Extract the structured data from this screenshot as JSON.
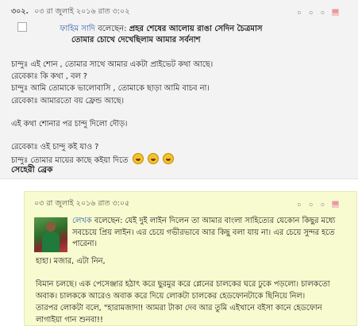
{
  "comment1": {
    "number": "৩০২.",
    "date": "০৩ রা জুলাই ২০১৬ রাত ৩:০২",
    "tools": [
      "০",
      "০",
      "০"
    ],
    "author": "ফাহিম সাদি",
    "said": "বলেছেন:",
    "title_line1": "প্রহর শেষের আলোয় রাঙা সেদিন চৈত্রমাস",
    "title_line2": "তোমার চোখে দেখেছিলাম আমার সর্বনাশ",
    "lines": [
      "চান্দুঃ এই শোন , তোমার সাথে আমার একটা প্রাইভেট কথা আছে।",
      "রেবেকাঃ কি কথা , বল ?",
      "চান্দুঃ আমি তোমাকে ভালোবাসি , তোমাকে ছাড়া আমি বাচব না।",
      "রেবেকাঃ আমারতো বয় ফ্রেন্ড আছে।",
      "",
      "এই কথা শোনার পর চান্দু দিলো দৌড়।",
      "",
      "রেবেকাঃ ওই চান্দু কই যাও ?",
      "চান্দুঃ তোমার মায়ের কাছে কইয়া দিতে"
    ],
    "signature": "সেহেরী ব্রেক",
    "emoticons": [
      "laughing-emoticon",
      "laughing-emoticon",
      "laughing-emoticon"
    ]
  },
  "comment2": {
    "date": "০৩ রা জুলাই ২০১৬ রাত ৩:০৫",
    "tools": [
      "০",
      "০",
      "০"
    ],
    "author": "লেখক",
    "said": "বলেছেন:",
    "reply": "যেই দুই লাইন দিলেন তা আমার বাংলা সাহিত্যের যেকোন কিছুর মধ্যে সবচেয়ে প্রিয় লাইন। এর চেয়ে গভীরভাবে আর কিছু বলা যায় না। এর চেয়ে সুন্দর হতে পারেনা।",
    "lines": [
      "হাহা। মজার, এটা নিন,",
      "",
      "বিমান চলছে। এক পেসেঞ্জার হঠাৎ করে ছুরমুর করে প্লেনের চালকের ঘরে ঢুকে পড়লো। চালকতো অবাক। চালককে আরেও অবাক করে দিয়ে লোকটা চালকের হেডফোনটাকে ছিনিয়ে নিল।",
      "তারপর লোকটা বলে, \"হারামজাদা! আমরা টাকা দেব আর তুমি এইখানে বইসা কানে হেডফোন লাগাইয়া গান শুনবা!!"
    ]
  },
  "colors": {
    "link": "#3a5ea8",
    "comment2_bg": "#f7fbcf",
    "comment1_bg": "#f3f3f3"
  }
}
